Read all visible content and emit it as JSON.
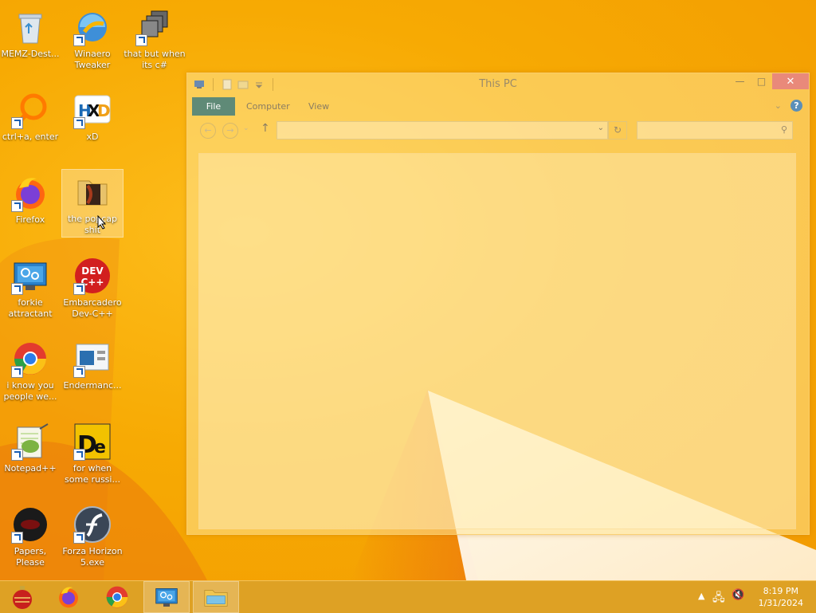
{
  "desktop": {
    "icons": [
      {
        "label": "MEMZ-Dest...",
        "icon": "recycle-bin-icon",
        "shortcut": false
      },
      {
        "label": "Winaero Tweaker",
        "icon": "winaero-icon",
        "shortcut": true
      },
      {
        "label": "that but when its c#",
        "icon": "windows-stack-icon",
        "shortcut": true
      },
      {
        "label": "ctrl+a, enter",
        "icon": "magnifier-ring-icon",
        "shortcut": true
      },
      {
        "label": "xD",
        "icon": "hxd-icon",
        "shortcut": true
      },
      {
        "label": "Firefox",
        "icon": "firefox-icon",
        "shortcut": true
      },
      {
        "label": "the popcap shit",
        "icon": "folder-icon",
        "shortcut": false,
        "selected": true
      },
      {
        "label": "forkie attractant",
        "icon": "monitor-gear-icon",
        "shortcut": true
      },
      {
        "label": "Embarcadero Dev-C++",
        "icon": "devcpp-icon",
        "shortcut": true
      },
      {
        "label": "i know you people we...",
        "icon": "chrome-icon",
        "shortcut": true
      },
      {
        "label": "Endermanc...",
        "icon": "window-app-icon",
        "shortcut": true
      },
      {
        "label": "Notepad++",
        "icon": "notepad-plus-plus-icon",
        "shortcut": true
      },
      {
        "label": "for when some russi...",
        "icon": "de-icon",
        "shortcut": true
      },
      {
        "label": "Papers, Please",
        "icon": "papers-please-icon",
        "shortcut": true
      },
      {
        "label": "Forza Horizon 5.exe",
        "icon": "flash-icon",
        "shortcut": true
      }
    ]
  },
  "window": {
    "title": "This PC",
    "close_glyph": "✕",
    "minimize_glyph": "—",
    "maximize_glyph": "□",
    "tabs": [
      "File",
      "Computer",
      "View"
    ],
    "help_glyph": "?",
    "refresh_glyph": "↻",
    "search_glyph": "⚲",
    "address_value": "",
    "search_value": ""
  },
  "taskbar": {
    "pinned": [
      "christmas-ornament-icon",
      "firefox-icon",
      "chrome-icon",
      "monitor-gear-icon",
      "file-explorer-icon"
    ],
    "active_index": 4,
    "clock": {
      "time": "8:19 PM",
      "date": "1/31/2024"
    }
  },
  "colors": {
    "file_tab": "#5f8a77",
    "close_button": "#e9897a",
    "wallpaper": "#f7aa03"
  }
}
